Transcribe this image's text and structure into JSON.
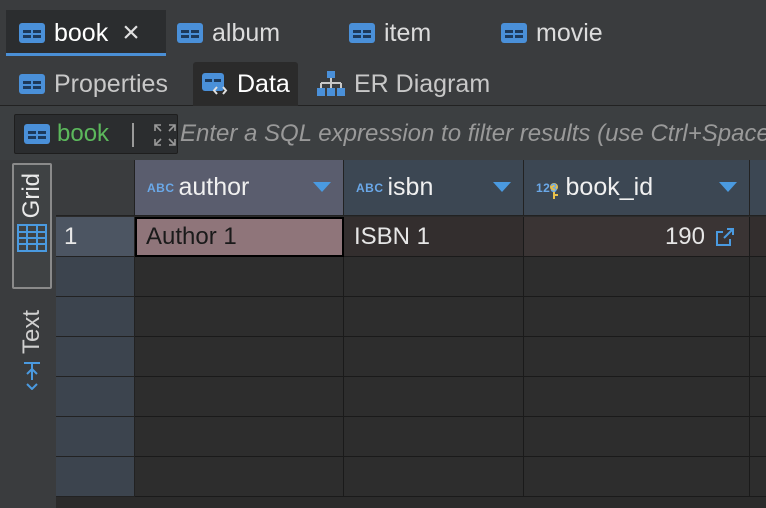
{
  "editor_tabs": [
    {
      "label": "book",
      "icon": "table-icon",
      "active": true,
      "closable": true
    },
    {
      "label": "album",
      "icon": "table-icon"
    },
    {
      "label": "item",
      "icon": "table-icon"
    },
    {
      "label": "movie",
      "icon": "table-icon"
    }
  ],
  "sub_tabs": [
    {
      "label": "Properties",
      "icon": "table-icon"
    },
    {
      "label": "Data",
      "icon": "data-table-icon",
      "active": true
    },
    {
      "label": "ER Diagram",
      "icon": "er-diagram-icon"
    }
  ],
  "filter": {
    "entity": "book",
    "placeholder": "Enter a SQL expression to filter results (use Ctrl+Space)"
  },
  "side_panels": {
    "grid": "Grid",
    "text": "Text"
  },
  "columns": [
    {
      "name": "author",
      "type_badge": "ABC"
    },
    {
      "name": "isbn",
      "type_badge": "ABC"
    },
    {
      "name": "book_id",
      "type_badge": "123"
    }
  ],
  "rows": [
    {
      "num": "1",
      "author": "Author 1",
      "isbn": "ISBN 1",
      "book_id": "190"
    }
  ],
  "colors": {
    "accent": "#4a8fd6",
    "entity_name": "#5cb85c",
    "focused_cell": "#8f757a"
  }
}
